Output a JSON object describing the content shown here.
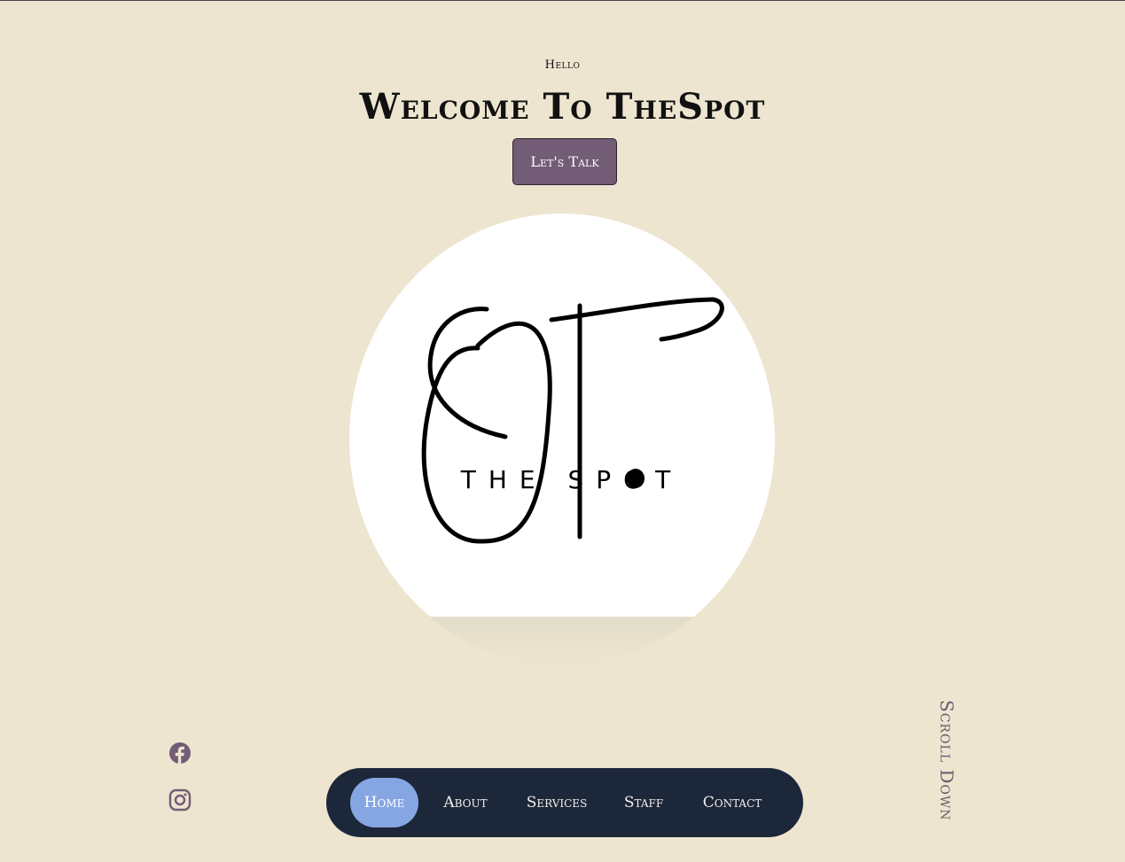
{
  "hero": {
    "greeting": "Hello",
    "title": "Welcome To TheSpot",
    "cta_label": "Let's Talk"
  },
  "logo": {
    "icon": "thespot-monogram-logo",
    "text": "THE SPOT"
  },
  "social": {
    "items": [
      {
        "icon": "facebook-icon"
      },
      {
        "icon": "instagram-icon"
      }
    ]
  },
  "nav": {
    "items": [
      {
        "label": "Home",
        "active": true
      },
      {
        "label": "About",
        "active": false
      },
      {
        "label": "Services",
        "active": false
      },
      {
        "label": "Staff",
        "active": false
      },
      {
        "label": "Contact",
        "active": false
      }
    ]
  },
  "scroll_down": "Scroll Down",
  "colors": {
    "background": "#ede5cf",
    "cta": "#735c75",
    "nav_bg": "#1d273a",
    "nav_active": "#86a6e3",
    "accent_text": "#6b5a6c"
  }
}
